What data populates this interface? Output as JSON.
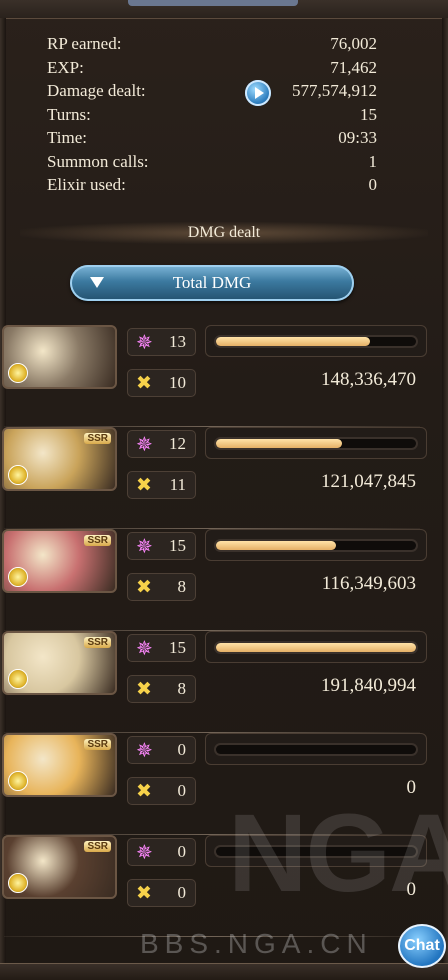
{
  "stats": {
    "rp_label": "RP earned:",
    "rp_value": "76,002",
    "exp_label": "EXP:",
    "exp_value": "71,462",
    "damage_label": "Damage dealt:",
    "damage_value": "577,574,912",
    "turns_label": "Turns:",
    "turns_value": "15",
    "time_label": "Time:",
    "time_value": "09:33",
    "summon_label": "Summon calls:",
    "summon_value": "1",
    "elixir_label": "Elixir used:",
    "elixir_value": "0"
  },
  "dmg_section_title": "DMG dealt",
  "total_dmg_button": "Total DMG",
  "characters": [
    {
      "charge_attacks": "13",
      "skills": "10",
      "damage": "148,336,470",
      "bar_fraction": 0.77,
      "ssr": "",
      "portrait_color": "#8a7a66"
    },
    {
      "charge_attacks": "12",
      "skills": "11",
      "damage": "121,047,845",
      "bar_fraction": 0.63,
      "ssr": "SSR",
      "portrait_color": "#c9a35a"
    },
    {
      "charge_attacks": "15",
      "skills": "8",
      "damage": "116,349,603",
      "bar_fraction": 0.6,
      "ssr": "SSR",
      "portrait_color": "#c87070"
    },
    {
      "charge_attacks": "15",
      "skills": "8",
      "damage": "191,840,994",
      "bar_fraction": 1.0,
      "ssr": "SSR",
      "portrait_color": "#d8c7a0"
    },
    {
      "charge_attacks": "0",
      "skills": "0",
      "damage": "0",
      "bar_fraction": 0.0,
      "ssr": "SSR",
      "portrait_color": "#e8b45a"
    },
    {
      "charge_attacks": "0",
      "skills": "0",
      "damage": "0",
      "bar_fraction": 0.0,
      "ssr": "SSR",
      "portrait_color": "#5a4030"
    }
  ],
  "watermark": "BBS.NGA.CN",
  "watermark_big": "NGA",
  "chat_button": "Chat",
  "icons": {
    "play": "play-icon",
    "charge": "charge-attack-star-icon",
    "skill": "skill-cross-icon",
    "dropdown": "triangle-down-icon"
  }
}
